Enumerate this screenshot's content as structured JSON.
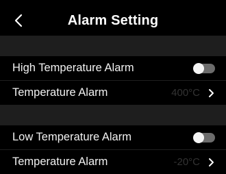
{
  "header": {
    "title": "Alarm Setting",
    "back_icon": "chevron-left-icon"
  },
  "high_group": {
    "toggle_label": "High Temperature Alarm",
    "toggle_on": false,
    "threshold_label": "Temperature Alarm",
    "threshold_value": "400°C"
  },
  "low_group": {
    "toggle_label": "Low Temperature Alarm",
    "toggle_on": false,
    "threshold_label": "Temperature Alarm",
    "threshold_value": "-20°C"
  },
  "colors": {
    "background": "#000000",
    "section_gap": "#1e1e1e",
    "toggle_track": "#6c6c6c",
    "dim_value": "#333333"
  }
}
